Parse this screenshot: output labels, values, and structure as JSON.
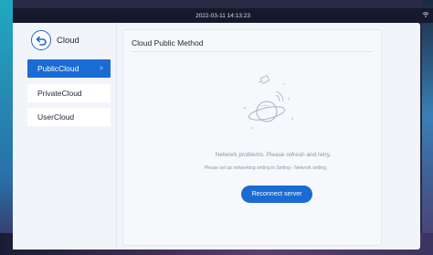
{
  "statusbar": {
    "datetime": "2022-03-11 14:13:23"
  },
  "sidebar": {
    "title": "Cloud",
    "items": [
      {
        "label": "PublicCloud",
        "active": true,
        "chevron": ">"
      },
      {
        "label": "PrivateCloud",
        "active": false
      },
      {
        "label": "UserCloud",
        "active": false
      }
    ]
  },
  "panel": {
    "title": "Cloud Public Method",
    "message": "Network problems. Please refresh and retry.",
    "hint": "Please set up networking setting in Setting - Network setting.",
    "button_label": "Reconnect server"
  },
  "colors": {
    "accent": "#1b6bd4",
    "statusbar_bg": "#141a2b",
    "window_bg": "#f1f4f8"
  },
  "icons": {
    "back": "back-arrow-icon",
    "wifi": "wifi-icon",
    "illustration": "disconnected-planet-icon"
  }
}
